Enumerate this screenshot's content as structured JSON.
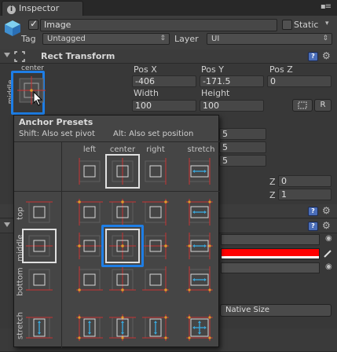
{
  "tab": {
    "label": "Inspector",
    "menu_icon": "context-menu-icon"
  },
  "header": {
    "object_name": "Image",
    "active": true,
    "static_label": "Static",
    "tag_label": "Tag",
    "tag_value": "Untagged",
    "layer_label": "Layer",
    "layer_value": "UI"
  },
  "rect_transform": {
    "title": "Rect Transform",
    "anchor_h_label": "center",
    "anchor_v_label": "middle",
    "pos_x_label": "Pos X",
    "pos_y_label": "Pos Y",
    "pos_z_label": "Pos Z",
    "pos_x": "-406",
    "pos_y": "-171.5",
    "pos_z": "0",
    "width_label": "Width",
    "height_label": "Height",
    "width": "100",
    "height": "100",
    "raw_edit_label": "R",
    "partial_values": [
      "5",
      "5",
      "5"
    ],
    "z_label_1": "Z",
    "z_value_1": "0",
    "z_label_2": "Z",
    "z_value_2": "1"
  },
  "image_component": {
    "set_native_size_partial": "Native Size",
    "color": "#ff0000"
  },
  "anchor_presets": {
    "title": "Anchor Presets",
    "hint_shift": "Shift: Also set pivot",
    "hint_alt": "Alt: Also set position",
    "columns": [
      "left",
      "center",
      "right",
      "stretch"
    ],
    "rows": [
      "top",
      "middle",
      "bottom",
      "stretch"
    ]
  },
  "colors": {
    "selection_blue": "#1e7ee6",
    "anchor_red": "#c83232",
    "anchor_orange": "#e09a2a",
    "stretch_blue": "#3aa6d8"
  }
}
